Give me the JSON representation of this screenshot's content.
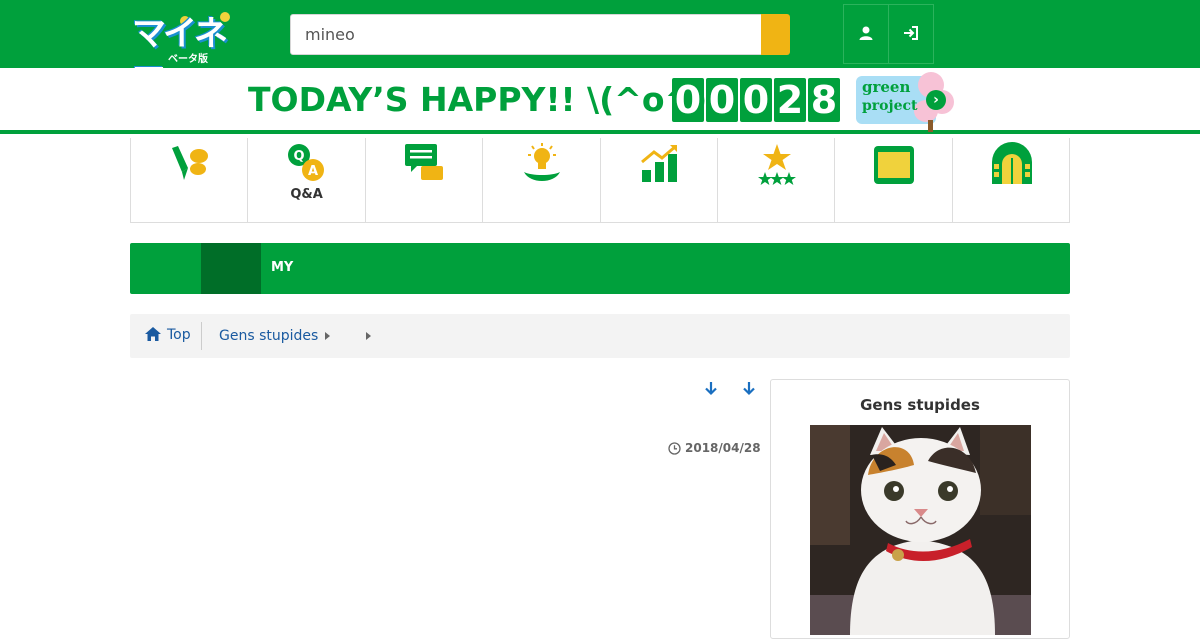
{
  "header": {
    "logo_text": "マイネ王",
    "logo_sub": "ベータ版",
    "search_value": "mineo"
  },
  "banner": {
    "text": "TODAY’S HAPPY!! \\(^o^)/",
    "counter_digits": [
      "0",
      "0",
      "0",
      "2",
      "8"
    ],
    "green_project_line1": "green",
    "green_project_line2": "project",
    "green_project_arrow": "›"
  },
  "categories": [
    {
      "icon": "pen-chat-icon",
      "label": ""
    },
    {
      "icon": "qa-icon",
      "label": "Q&A"
    },
    {
      "icon": "speech-bubbles-icon",
      "label": ""
    },
    {
      "icon": "lightbulb-icon",
      "label": ""
    },
    {
      "icon": "chart-up-icon",
      "label": ""
    },
    {
      "icon": "stars-icon",
      "label": ""
    },
    {
      "icon": "folder-icon",
      "label": ""
    },
    {
      "icon": "door-icon",
      "label": ""
    }
  ],
  "mybar": {
    "label": "MY"
  },
  "breadcrumb": {
    "top": "Top",
    "item": "Gens stupides"
  },
  "content": {
    "date": "2018/04/28"
  },
  "sidebar": {
    "title": "Gens stupides"
  },
  "colors": {
    "brand_green": "#00a03c",
    "dark_green": "#006e28",
    "accent_yellow": "#f0b414",
    "link_blue": "#1a5aa0"
  }
}
